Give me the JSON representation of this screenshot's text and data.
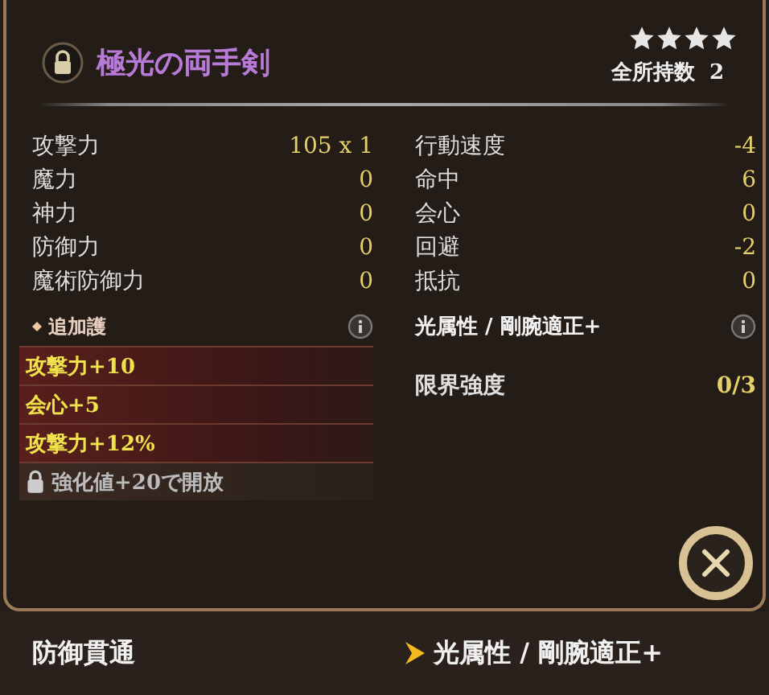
{
  "item": {
    "name": "極光の両手剣",
    "stars": 4,
    "owned_label": "全所持数",
    "owned_count": "2"
  },
  "stats_left": [
    {
      "label": "攻撃力",
      "value": "105 x 1"
    },
    {
      "label": "魔力",
      "value": "0"
    },
    {
      "label": "神力",
      "value": "0"
    },
    {
      "label": "防御力",
      "value": "0"
    },
    {
      "label": "魔術防御力",
      "value": "0"
    }
  ],
  "stats_right": [
    {
      "label": "行動速度",
      "value": "-4"
    },
    {
      "label": "命中",
      "value": "6"
    },
    {
      "label": "会心",
      "value": "0"
    },
    {
      "label": "回避",
      "value": "-2"
    },
    {
      "label": "抵抗",
      "value": "0"
    }
  ],
  "extra": {
    "title": "追加護",
    "effects": [
      {
        "kind": "effect",
        "text": "攻撃力+10"
      },
      {
        "kind": "effect",
        "text": "会心+5"
      },
      {
        "kind": "effect",
        "text": "攻撃力+12%"
      },
      {
        "kind": "locked",
        "text": "強化値+20で開放"
      }
    ]
  },
  "attribute": "光属性 / 剛腕適正+",
  "limit": {
    "label": "限界強度",
    "value": "0/3"
  },
  "footer": {
    "left": "防御貫通",
    "right": "光属性 / 剛腕適正+"
  }
}
